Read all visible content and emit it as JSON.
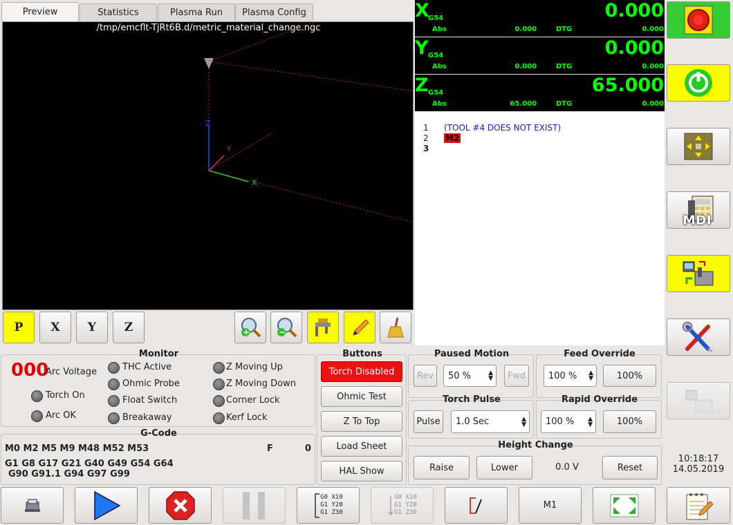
{
  "tabs": [
    "Preview",
    "Statistics",
    "Plasma Run",
    "Plasma Config"
  ],
  "preview": {
    "filename": "/tmp/emcflt-TjRt6B.d/metric_material_change.ngc",
    "axis_labels": {
      "x": "X",
      "y": "Y",
      "z": "Z"
    }
  },
  "view_buttons": {
    "p": "P",
    "x": "X",
    "y": "Y",
    "z": "Z"
  },
  "dro": [
    {
      "axis": "X",
      "cs": "G54",
      "value": "0.000",
      "abs_label": "Abs",
      "abs": "0.000",
      "dtg_label": "DTG",
      "dtg": "0.000"
    },
    {
      "axis": "Y",
      "cs": "G54",
      "value": "0.000",
      "abs_label": "Abs",
      "abs": "0.000",
      "dtg_label": "DTG",
      "dtg": "0.000"
    },
    {
      "axis": "Z",
      "cs": "G54",
      "value": "65.000",
      "abs_label": "Abs",
      "abs": "65.000",
      "dtg_label": "DTG",
      "dtg": "0.000"
    }
  ],
  "gcode": [
    {
      "num": "1",
      "text": "(TOOL #4 DOES NOT EXIST)"
    },
    {
      "num": "2",
      "text": "M2"
    },
    {
      "num": "3",
      "text": ""
    }
  ],
  "monitor": {
    "title": "Monitor",
    "arc_voltage_value": "000",
    "arc_voltage_label": "Arc Voltage",
    "torch_on": "Torch On",
    "arc_ok": "Arc OK",
    "thc_active": "THC Active",
    "ohmic_probe": "Ohmic Probe",
    "float_switch": "Float Switch",
    "breakaway": "Breakaway",
    "z_moving_up": "Z Moving Up",
    "z_moving_down": "Z Moving Down",
    "corner_lock": "Corner Lock",
    "kerf_lock": "Kerf Lock"
  },
  "gcode_panel": {
    "title": "G-Code",
    "line1": "M0 M2 M5 M9 M48 M52 M53",
    "f_label": "F",
    "f_value": "0",
    "line2": "G1 G8 G17 G21 G40 G49 G54 G64",
    "line3": "G90 G91.1 G94 G97 G99"
  },
  "buttons": {
    "title": "Buttons",
    "torch_disabled": "Torch Disabled",
    "ohmic_test": "Ohmic Test",
    "z_to_top": "Z To Top",
    "load_sheet": "Load Sheet",
    "hal_show": "HAL Show"
  },
  "paused_motion": {
    "title": "Paused Motion",
    "rev": "Rev",
    "speed": "50 %",
    "fwd": "Fwd"
  },
  "feed_override": {
    "title": "Feed Override",
    "value": "100 %",
    "reset": "100%"
  },
  "torch_pulse": {
    "title": "Torch Pulse",
    "pulse": "Pulse",
    "time": "1.0 Sec"
  },
  "rapid_override": {
    "title": "Rapid Override",
    "value": "100 %",
    "reset": "100%"
  },
  "height_change": {
    "title": "Height Change",
    "raise": "Raise",
    "lower": "Lower",
    "voltage": "0.0 V",
    "reset": "Reset"
  },
  "clock": {
    "time": "10:18:17",
    "date": "14.05.2019"
  },
  "right_buttons": {
    "mdi_label": "MDI"
  },
  "bottom_bar": {
    "touchoff_lines": [
      "G0 X10",
      "G1 Y20",
      "G1 Z30"
    ],
    "m1_label": "M1"
  },
  "colors": {
    "dro_green": "#00ff00",
    "estop_green": "#33cc33",
    "highlight_yellow": "#fafa00",
    "torch_red": "#ee1111",
    "arc_voltage_red": "#e00000"
  }
}
